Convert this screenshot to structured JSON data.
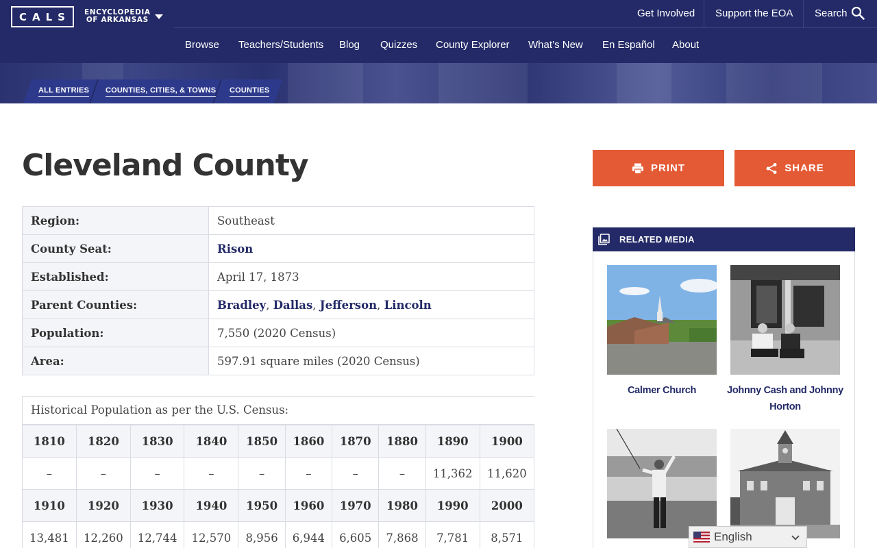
{
  "header": {
    "logo_text": "CALS",
    "logo_line1": "ENCYCLOPEDIA",
    "logo_line2": "OF ARKANSAS",
    "utility": [
      "Get Involved",
      "Support the EOA",
      "Search"
    ],
    "nav": [
      "Browse",
      "Teachers/Students",
      "Blog",
      "Quizzes",
      "County Explorer",
      "What’s New",
      "En Español",
      "About"
    ]
  },
  "breadcrumbs": [
    "ALL ENTRIES",
    "COUNTIES, CITIES, & TOWNS",
    "COUNTIES"
  ],
  "page_title": "Cleveland County",
  "actions": {
    "print": "PRINT",
    "share": "SHARE"
  },
  "info": {
    "region_label": "Region:",
    "region": "Southeast",
    "seat_label": "County Seat:",
    "seat": "Rison",
    "established_label": "Established:",
    "established": "April 17, 1873",
    "parents_label": "Parent Counties:",
    "parents": [
      "Bradley",
      "Dallas",
      "Jefferson",
      "Lincoln"
    ],
    "parents_sep": ", ",
    "population_label": "Population:",
    "population": "7,550 (2020 Census)",
    "area_label": "Area:",
    "area": "597.91 square miles (2020 Census)"
  },
  "census": {
    "caption": "Historical Population as per the U.S. Census:",
    "years_row1": [
      "1810",
      "1820",
      "1830",
      "1840",
      "1850",
      "1860",
      "1870",
      "1880",
      "1890",
      "1900"
    ],
    "pops_row1": [
      "–",
      "–",
      "–",
      "–",
      "–",
      "–",
      "–",
      "–",
      "11,362",
      "11,620"
    ],
    "years_row2": [
      "1910",
      "1920",
      "1930",
      "1940",
      "1950",
      "1960",
      "1970",
      "1980",
      "1990",
      "2000"
    ],
    "pops_row2": [
      "13,481",
      "12,260",
      "12,744",
      "12,570",
      "8,956",
      "6,944",
      "6,605",
      "7,868",
      "7,781",
      "8,571"
    ]
  },
  "related_media": {
    "title": "RELATED MEDIA",
    "items": [
      "Calmer Church",
      "Johnny Cash and Johnny Horton",
      "",
      ""
    ]
  },
  "language": {
    "selected": "English"
  },
  "colors": {
    "navy": "#232a67",
    "accent": "#e45a35"
  }
}
